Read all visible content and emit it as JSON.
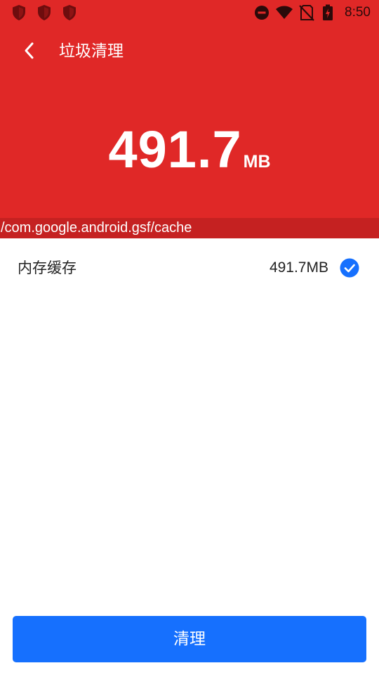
{
  "status_bar": {
    "time": "8:50",
    "left_icons": [
      "shield-icon",
      "shield-icon",
      "shield-icon"
    ],
    "right_icons": [
      "do-not-disturb-icon",
      "wifi-icon",
      "no-sim-icon",
      "battery-charging-icon"
    ]
  },
  "toolbar": {
    "back_icon": "back-arrow-icon",
    "title": "垃圾清理"
  },
  "summary": {
    "size_value": "491.7",
    "size_unit": "MB",
    "scan_path": "/com.google.android.gsf/cache"
  },
  "items": [
    {
      "label": "内存缓存",
      "size": "491.7MB",
      "checked": true
    }
  ],
  "actions": {
    "clean_label": "清理"
  },
  "colors": {
    "header": "#e02827",
    "path_bar": "#c52121",
    "accent": "#1670fe",
    "status_icon": "#7a0f10"
  }
}
